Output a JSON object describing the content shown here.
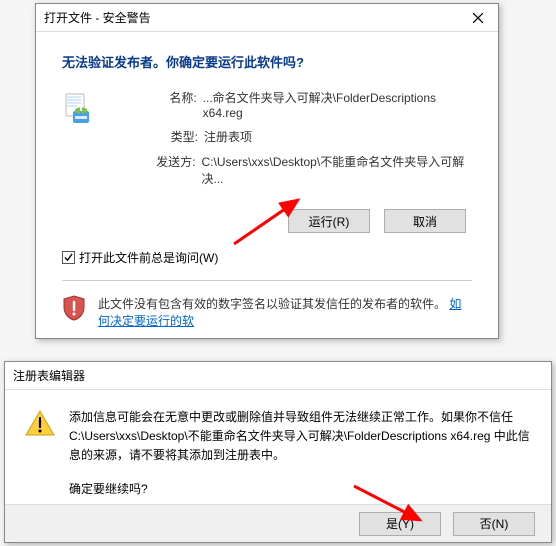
{
  "dlg1": {
    "title": "打开文件 - 安全警告",
    "heading": "无法验证发布者。你确定要运行此软件吗?",
    "rows": {
      "name_k": "名称:",
      "name_v": "...命名文件夹导入可解决\\FolderDescriptions x64.reg",
      "type_k": "类型:",
      "type_v": "注册表项",
      "from_k": "发送方:",
      "from_v": "C:\\Users\\xxs\\Desktop\\不能重命名文件夹导入可解决..."
    },
    "run_btn": "运行(R)",
    "cancel_btn": "取消",
    "checkbox": "打开此文件前总是询问(W)",
    "warn_text": "此文件没有包含有效的数字签名以验证其发信任的发布者的软件。",
    "warn_link": "如何决定要运行的软"
  },
  "dlg2": {
    "title": "注册表编辑器",
    "body1": "添加信息可能会在无意中更改或删除值并导致组件无法继续正常工作。如果你不信任 C:\\Users\\xxs\\Desktop\\不能重命名文件夹导入可解决\\FolderDescriptions x64.reg 中此信息的来源，请不要将其添加到注册表中。",
    "body2": "确定要继续吗?",
    "yes_btn": "是(Y)",
    "no_btn": "否(N)"
  }
}
